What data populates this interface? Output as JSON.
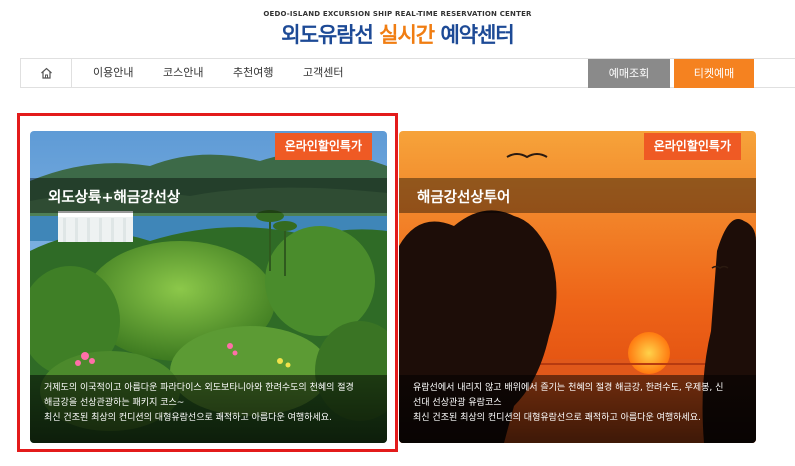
{
  "header": {
    "subtitle": "OEDO-ISLAND EXCURSION SHIP REAL-TIME RESERVATION CENTER",
    "title_part1": "외도유람선",
    "title_part2": "실시간",
    "title_part3": "예약센터"
  },
  "nav": {
    "home_icon": "home-icon",
    "items": [
      {
        "label": "이용안내"
      },
      {
        "label": "코스안내"
      },
      {
        "label": "추천여행"
      },
      {
        "label": "고객센터"
      }
    ],
    "inquiry_label": "예매조회",
    "ticket_label": "티켓예매"
  },
  "cards": [
    {
      "badge": "온라인할인특가",
      "title": "외도상륙+해금강선상",
      "desc_lines": [
        "거제도의 이국적이고 아름다운 파라다이스 외도보타니아와 한려수도의 천혜의 절경",
        "해금강을 선상관광하는 패키지 코스~",
        "최신 건조된 최상의 컨디션의 대형유람선으로 쾌적하고 아름다운 여행하세요."
      ]
    },
    {
      "badge": "온라인할인특가",
      "title": "해금강선상투어",
      "desc_lines": [
        "유람선에서 내리지 않고 배위에서 즐기는 천혜의 절경 해금강, 한려수도, 우제봉, 신",
        "선대 선상관광 유람코스",
        "최신 건조된 최상의 컨디션의 대형유람선으로 쾌적하고 아름다운 여행하세요."
      ]
    }
  ],
  "colors": {
    "brand_blue": "#1d4a96",
    "brand_orange": "#f07d12",
    "ticket_orange": "#f58220",
    "inquiry_gray": "#8a8a8a",
    "badge_orange": "#ef5a24",
    "highlight_red": "#e31b1b"
  }
}
